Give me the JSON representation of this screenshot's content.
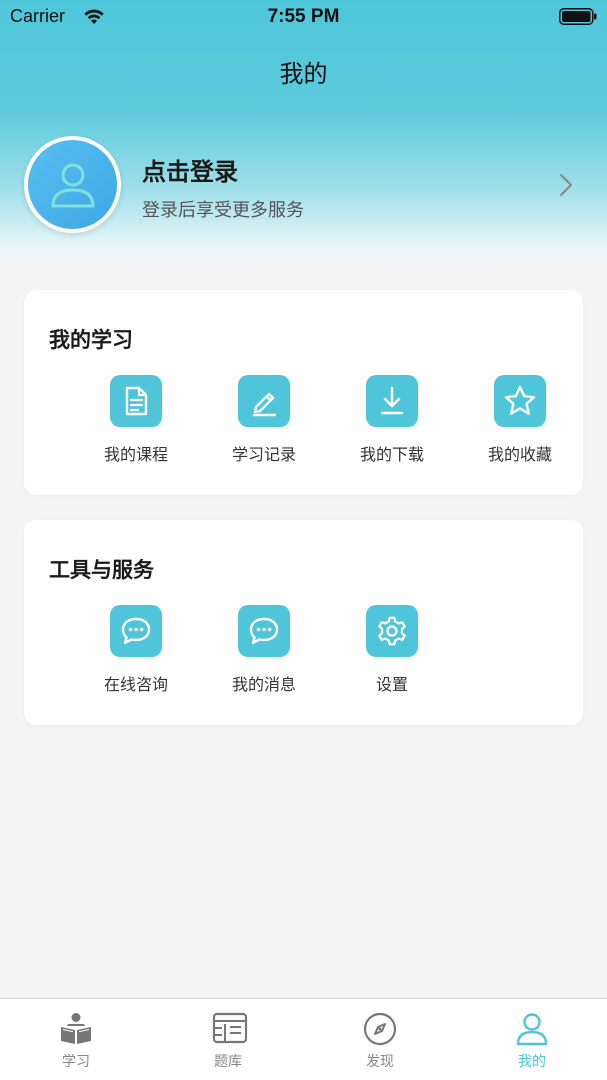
{
  "status_bar": {
    "carrier": "Carrier",
    "time": "7:55 PM"
  },
  "nav": {
    "title": "我的"
  },
  "profile": {
    "title": "点击登录",
    "subtitle": "登录后享受更多服务"
  },
  "learning": {
    "title": "我的学习",
    "items": [
      {
        "label": "我的课程",
        "icon": "document-icon"
      },
      {
        "label": "学习记录",
        "icon": "pencil-icon"
      },
      {
        "label": "我的下载",
        "icon": "download-icon"
      },
      {
        "label": "我的收藏",
        "icon": "star-icon"
      }
    ]
  },
  "tools": {
    "title": "工具与服务",
    "items": [
      {
        "label": "在线咨询",
        "icon": "chat-bubble-icon"
      },
      {
        "label": "我的消息",
        "icon": "message-icon"
      },
      {
        "label": "设置",
        "icon": "gear-icon"
      }
    ]
  },
  "tab_bar": {
    "tabs": [
      {
        "label": "学习",
        "icon": "reader-book-icon"
      },
      {
        "label": "题库",
        "icon": "question-bank-icon"
      },
      {
        "label": "发现",
        "icon": "compass-icon"
      },
      {
        "label": "我的",
        "icon": "user-icon",
        "active": true
      }
    ]
  },
  "colors": {
    "accent": "#4fc5da",
    "header_top": "#4ec6da",
    "avatar": "#3da7e6",
    "background": "#f4f4f5"
  }
}
